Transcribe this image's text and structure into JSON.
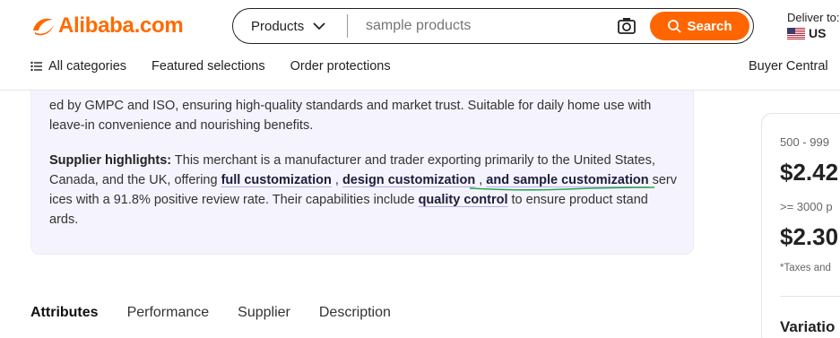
{
  "header": {
    "logo_text": "Alibaba.com",
    "search": {
      "category": "Products",
      "placeholder": "sample products",
      "button_label": "Search"
    },
    "deliver": {
      "label": "Deliver to:",
      "country": "US"
    },
    "nav": {
      "all_categories": "All categories",
      "featured": "Featured selections",
      "protections": "Order protections",
      "buyer_central": "Buyer Central"
    }
  },
  "highlights": {
    "p1_line1": "ed by GMPC and ISO, ensuring high-quality standards and market trust. Suitable for daily home use with",
    "p1_line2": "leave-in convenience and nourishing benefits.",
    "supplier_label": "Supplier highlights:",
    "supplier_text1": " This merchant is a manufacturer and trader exporting primarily to the United States,",
    "supplier_text2": "Canada, and the UK, offering ",
    "kw_full": "full customization",
    "sep1": " , ",
    "kw_design": "design customization",
    "sep2": " , ",
    "kw_sample": "and sample customization",
    "supplier_text3": "  serv",
    "supplier_text4": "ices with a 91.8% positive review rate. Their capabilities include ",
    "kw_quality": "quality control",
    "supplier_text5": "  to ensure product stand",
    "supplier_text6": "ards."
  },
  "price_panel": {
    "range1": "500 - 999",
    "price1": "$2.42",
    "range2": ">= 3000 p",
    "price2": "$2.30",
    "tax_note": "*Taxes and",
    "variations_title": "Variatio"
  },
  "tabs": [
    "Attributes",
    "Performance",
    "Supplier",
    "Description"
  ],
  "colors": {
    "brand_orange": "#ff6a00",
    "card_bg": "#f5f3fd",
    "underline_green": "#2aa84a"
  }
}
